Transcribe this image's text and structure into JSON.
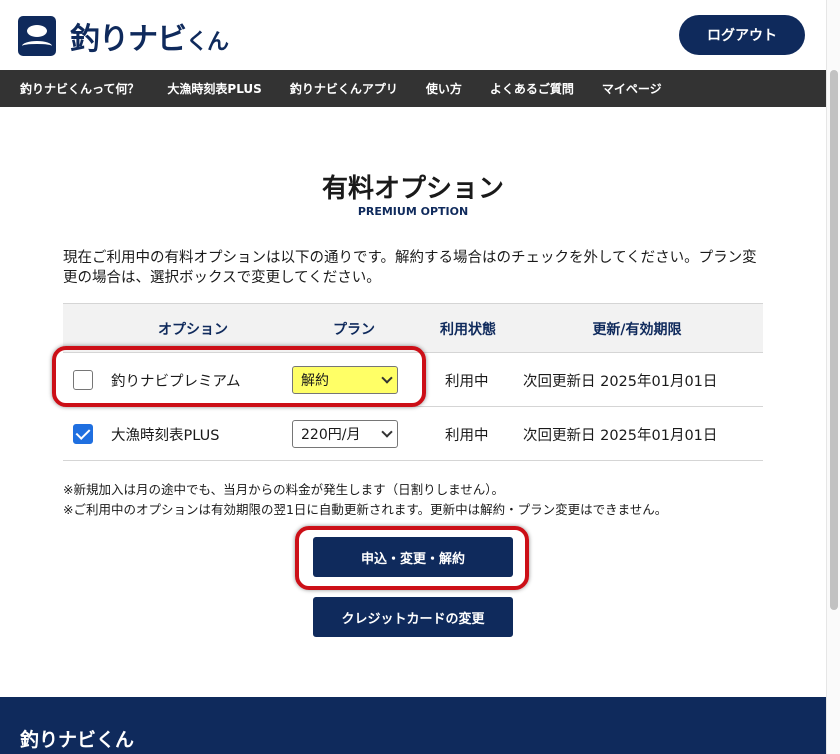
{
  "header": {
    "logo_text": "釣りナビ",
    "logo_text_small": "くん",
    "logout_label": "ログアウト"
  },
  "nav": {
    "items": [
      "釣りナビくんって何？",
      "大漁時刻表PLUS",
      "釣りナビくんアプリ",
      "使い方",
      "よくあるご質問",
      "マイページ"
    ]
  },
  "page": {
    "title": "有料オプション",
    "subtitle": "PREMIUM OPTION",
    "intro": "現在ご利用中の有料オプションは以下の通りです。解約する場合はのチェックを外してください。プラン変更の場合は、選択ボックスで変更してください。"
  },
  "table": {
    "headers": [
      "オプション",
      "プラン",
      "利用状態",
      "更新/有効期限"
    ],
    "rows": [
      {
        "checked": false,
        "name": "釣りナビプレミアム",
        "plan": "解約",
        "status": "利用中",
        "renewal": "次回更新日 2025年01月01日"
      },
      {
        "checked": true,
        "name": "大漁時刻表PLUS",
        "plan": "220円/月",
        "status": "利用中",
        "renewal": "次回更新日 2025年01月01日"
      }
    ]
  },
  "notes": [
    "※新規加入は月の途中でも、当月からの料金が発生します（日割りしません）。",
    "※ご利用中のオプションは有効期限の翌1日に自動更新されます。更新中は解約・プラン変更はできません。"
  ],
  "buttons": {
    "apply_label": "申込・変更・解約",
    "card_label": "クレジットカードの変更"
  },
  "footer": {
    "logo_text": "釣りナビくん"
  },
  "colors": {
    "brand_navy": "#0f2a5c",
    "nav_bg": "#333333",
    "highlight_red": "#cc0f17",
    "select_highlight": "#ffff66",
    "checkbox_blue": "#1f6fe0"
  }
}
